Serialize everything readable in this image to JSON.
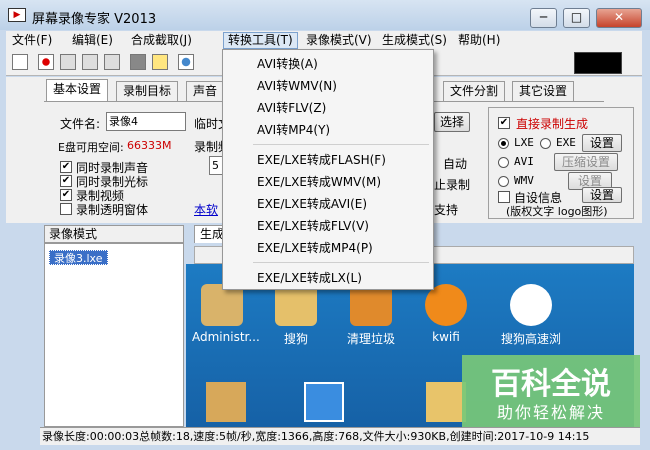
{
  "window": {
    "title": "屏幕录像专家 V2013",
    "min": "─",
    "max": "□",
    "close": "✕"
  },
  "menu": [
    "文件(F)",
    "编辑(E)",
    "合成截取(J)",
    "转换工具(T)",
    "录像模式(V)",
    "生成模式(S)",
    "帮助(H)"
  ],
  "dropdown": {
    "items": [
      "AVI转换(A)",
      "AVI转WMV(N)",
      "AVI转FLV(Z)",
      "AVI转MP4(Y)",
      "EXE/LXE转成FLASH(F)",
      "EXE/LXE转成WMV(M)",
      "EXE/LXE转成AVI(E)",
      "EXE/LXE转成FLV(V)",
      "EXE/LXE转成MP4(P)",
      "EXE/LXE转成LX(L)"
    ]
  },
  "tabs": [
    "基本设置",
    "录制目标",
    "声音",
    "文件分割",
    "其它设置"
  ],
  "basic": {
    "filename_label": "文件名:",
    "filename_value": "录像4",
    "temp_label": "临时文",
    "disk_label": "E盘可用空间:",
    "disk_value": "66333M",
    "record_freq_label": "录制频",
    "freq_value": "5",
    "checks": [
      "同时录制声音",
      "同时录制光标",
      "录制视频",
      "录制透明窗体"
    ],
    "checks_state": [
      true,
      true,
      true,
      false
    ],
    "link_text": "本软",
    "select_button": "选择",
    "auto_label": "自动",
    "stop_label": "止录制",
    "support_label": "支持"
  },
  "right_panel": {
    "direct_label": "直接录制生成",
    "formats": [
      "LXE",
      "EXE",
      "AVI",
      "WMV"
    ],
    "setup": "设置",
    "compress_setup": "压缩设置",
    "setup2": "设置",
    "custom_info": "自设信息",
    "setup3": "设置",
    "note": "(版权文字 logo图形)"
  },
  "tree": {
    "header": "录像模式",
    "item": "录像3.lxe"
  },
  "preview_tab": "生成",
  "desktop_icons": [
    "Administr...",
    "搜狗",
    "清理垃圾",
    "kwifi",
    "搜狗高速浏"
  ],
  "status": "录像长度:00:00:03总帧数:18,速度:5帧/秒,宽度:1366,高度:768,文件大小:930KB,创建时间:2017-10-9 14:15",
  "watermark": {
    "main": "百科全说",
    "sub": "助你轻松解决"
  },
  "colors": {
    "disk_value": "#cc0000",
    "direct_label": "#cc0000",
    "link": "#0000cc"
  }
}
